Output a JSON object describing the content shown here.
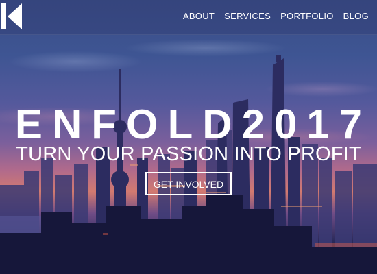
{
  "nav": {
    "logo_icon": "enfold-k-logo",
    "items": [
      {
        "label": "ABOUT"
      },
      {
        "label": "SERVICES"
      },
      {
        "label": "PORTFOLIO"
      },
      {
        "label": "BLOG"
      }
    ]
  },
  "hero": {
    "title": "ENFOLD2017",
    "subtitle": "TURN YOUR PASSION INTO PROFIT",
    "cta_label": "GET INVOLVED",
    "background": "city-skyline-dusk-image"
  },
  "colors": {
    "text": "#ffffff",
    "sky_top": "#3a4d86",
    "sky_glow": "#d27a70",
    "city_dark": "#141736"
  }
}
